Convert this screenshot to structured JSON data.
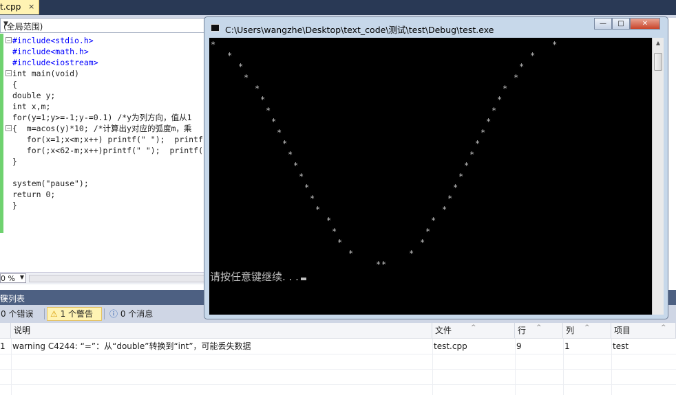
{
  "tab": {
    "name": "t.cpp",
    "close": "×"
  },
  "scope": {
    "label": "(全局范围)"
  },
  "code": {
    "lines": [
      "#include<stdio.h>",
      "#include<math.h>",
      "#include<iostream>",
      "int main(void)",
      "{",
      "double y;",
      "int x,m;",
      "for(y=1;y>=-1;y-=0.1) /*y为列方向，值从1",
      "{  m=acos(y)*10; /*计算出y对应的弧度m，乘",
      "   for(x=1;x<m;x++) printf(\" \");  printf",
      "   for(;x<62-m;x++)printf(\" \");  printf(",
      "}",
      "",
      "system(\"pause\");",
      "return 0;",
      "}"
    ]
  },
  "zoom": {
    "value": "0 %"
  },
  "console": {
    "title": "C:\\Users\\wangzhe\\Desktop\\text_code\\测试\\test\\Debug\\test.exe",
    "glyph": "*",
    "prompt": "请按任意键继续. . .",
    "buttons": {
      "minimize": "—",
      "maximize": "□",
      "close": "✕"
    }
  },
  "error_list": {
    "title": "误列表",
    "pin": "⊟",
    "filters": {
      "errors": "0 个错误",
      "warnings": "1 个警告",
      "messages": "0 个消息"
    },
    "columns": [
      "说明",
      "文件",
      "行",
      "列",
      "项目"
    ],
    "rows": [
      {
        "index": "1",
        "description": "warning C4244: “=”：从“double”转换到“int”，可能丢失数据",
        "file": "test.cpp",
        "line": "9",
        "column": "1",
        "project": "test"
      }
    ]
  },
  "colors": {
    "accent": "#293955",
    "panel_title": "#4d6082",
    "active_filter": "#fff3b3",
    "console_bg": "#000000",
    "console_text": "#c0c0c0"
  }
}
